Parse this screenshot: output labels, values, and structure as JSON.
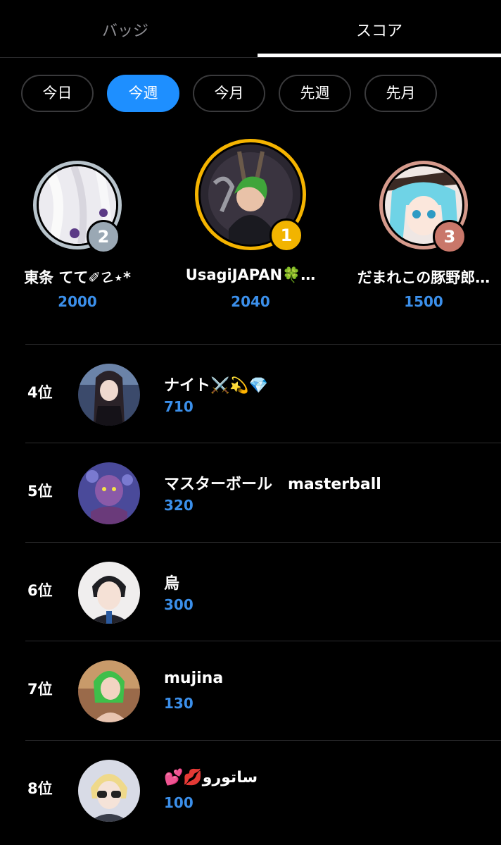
{
  "tabs": {
    "badge": "バッジ",
    "score": "スコア"
  },
  "periods": [
    "今日",
    "今週",
    "今月",
    "先週",
    "先月"
  ],
  "active_period": "今週",
  "podium": [
    {
      "rank": "2",
      "name": "東条 てて✐☡⋆*",
      "score": "2000",
      "badge_color": "#9aa8b4",
      "ring_color": "#b8c4cc"
    },
    {
      "rank": "1",
      "name": "UsagiJAPAN🍀…",
      "score": "2040",
      "badge_color": "#f2b400",
      "ring_color": "#f5b400"
    },
    {
      "rank": "3",
      "name": "だまれこの豚野郎…",
      "score": "1500",
      "badge_color": "#c9776a",
      "ring_color": "#d69a8c"
    }
  ],
  "list": [
    {
      "rank": "4位",
      "name": "ナイト⚔️💫💎",
      "score": "710"
    },
    {
      "rank": "5位",
      "name": "マスターボール　masterball",
      "score": "320"
    },
    {
      "rank": "6位",
      "name": "烏",
      "score": "300"
    },
    {
      "rank": "7位",
      "name": "mujina",
      "score": "130"
    },
    {
      "rank": "8位",
      "name": "💕💋ساتورو",
      "score": "100"
    }
  ],
  "colors": {
    "accent": "#1e8fff",
    "score": "#3b8fea",
    "background": "#000000"
  }
}
